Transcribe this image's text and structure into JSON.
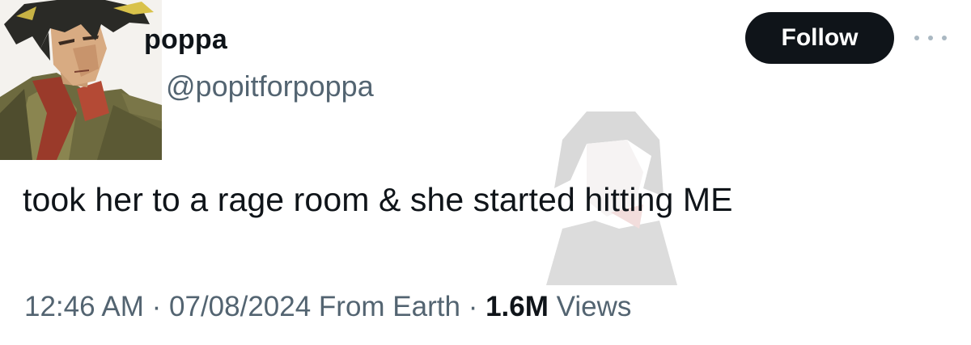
{
  "user": {
    "display_name": "poppa",
    "handle": "@popitforpoppa"
  },
  "follow_button": {
    "label": "Follow"
  },
  "more_icon": "more-horizontal-icon",
  "tweet": {
    "text": "took her to a rage room & she started hitting ME"
  },
  "meta": {
    "time": "12:46 AM",
    "separator": "·",
    "date": "07/08/2024",
    "source": "From Earth",
    "views_count": "1.6M",
    "views_label": "Views"
  },
  "colors": {
    "text_primary": "#0f1419",
    "text_secondary": "#536471",
    "button_bg": "#0f1419",
    "button_text": "#ffffff"
  }
}
